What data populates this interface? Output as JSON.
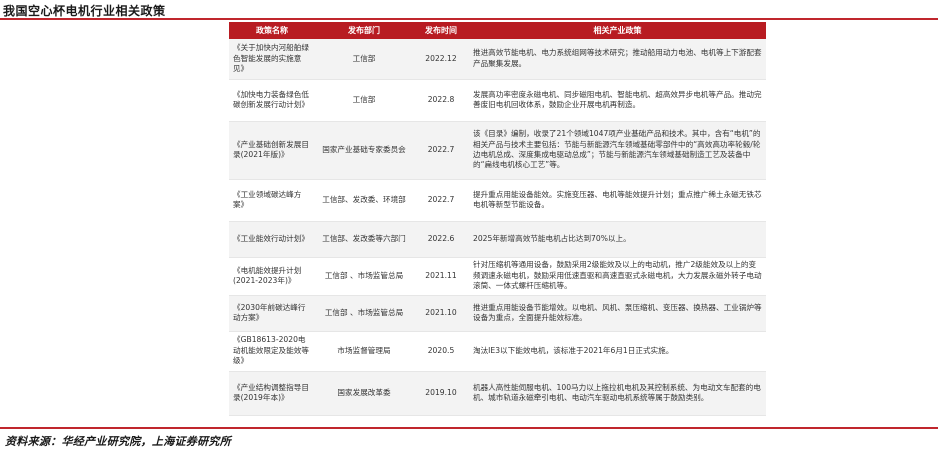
{
  "title": "我国空心杯电机行业相关政策",
  "source": "资料来源：华经产业研究院，上海证券研究所",
  "columns": [
    "政策名称",
    "发布部门",
    "发布时间",
    "相关产业政策"
  ],
  "rows": [
    {
      "name": "《关于加快内河船舶绿色智能发展的实施意见》",
      "dept": "工信部",
      "date": "2022.12",
      "desc": "推进高效节能电机、电力系统组网等技术研究；推动船用动力电池、电机等上下游配套产品聚集发展。"
    },
    {
      "name": "《加快电力装备绿色低碳创新发展行动计划》",
      "dept": "工信部",
      "date": "2022.8",
      "desc": "发展高功率密度永磁电机、同步磁阻电机、智能电机、超高效异步电机等产品。推动完善废旧电机回收体系，鼓励企业开展电机再制造。"
    },
    {
      "name": "《产业基础创新发展目录(2021年版)》",
      "dept": "国家产业基础专家委员会",
      "date": "2022.7",
      "desc": "该《目录》编制，收录了21个领域1047项产业基础产品和技术。其中，含有“电机”的相关产品与技术主要包括：节能与新能源汽车领域基础零部件中的“高效高功率轮毂/轮边电机总成、深度集成电驱动总成”；节能与新能源汽车领域基础制造工艺及装备中的“扁线电机核心工艺”等。"
    },
    {
      "name": "《工业领域碳达峰方案》",
      "dept": "工信部、发改委、环境部",
      "date": "2022.7",
      "desc": "提升重点用能设备能效。实施变压器、电机等能效提升计划；重点推广稀土永磁无铁芯电机等新型节能设备。"
    },
    {
      "name": "《工业能效行动计划》",
      "dept": "工信部、发改委等六部门",
      "date": "2022.6",
      "desc": "2025年新增高效节能电机占比达到70%以上。"
    },
    {
      "name": "《电机能效提升计划(2021-2023年)》",
      "dept": "工信部 、市场监管总局",
      "date": "2021.11",
      "desc": "针对压缩机等通用设备，鼓励采用2级能效及以上的电动机，推广2级能效及以上的变频调速永磁电机，鼓励采用低速直驱和高速直驱式永磁电机，大力发展永磁外转子电动滚筒、一体式螺杆压缩机等。"
    },
    {
      "name": "《2030年前碳达峰行动方案》",
      "dept": "工信部 、市场监管总局",
      "date": "2021.10",
      "desc": "推进重点用能设备节能增效。以电机、风机、泵压缩机、变压器、换热器、工业锅炉等设备为重点，全面提升能效标准。"
    },
    {
      "name": "《GB18613-2020电动机能效限定及能效等级》",
      "dept": "市场监督管理局",
      "date": "2020.5",
      "desc": "淘汰IE3以下能效电机，该标准于2021年6月1日正式实施。"
    },
    {
      "name": "《产业结构调整指导目录(2019年本)》",
      "dept": "国家发展改革委",
      "date": "2019.10",
      "desc": "机器人高性能伺服电机、100马力以上拖拉机电机及其控制系统、为电动文车配套的电机、城市轨道永磁牵引电机、电动汽车驱动电机系统等属于鼓励类别。"
    }
  ]
}
